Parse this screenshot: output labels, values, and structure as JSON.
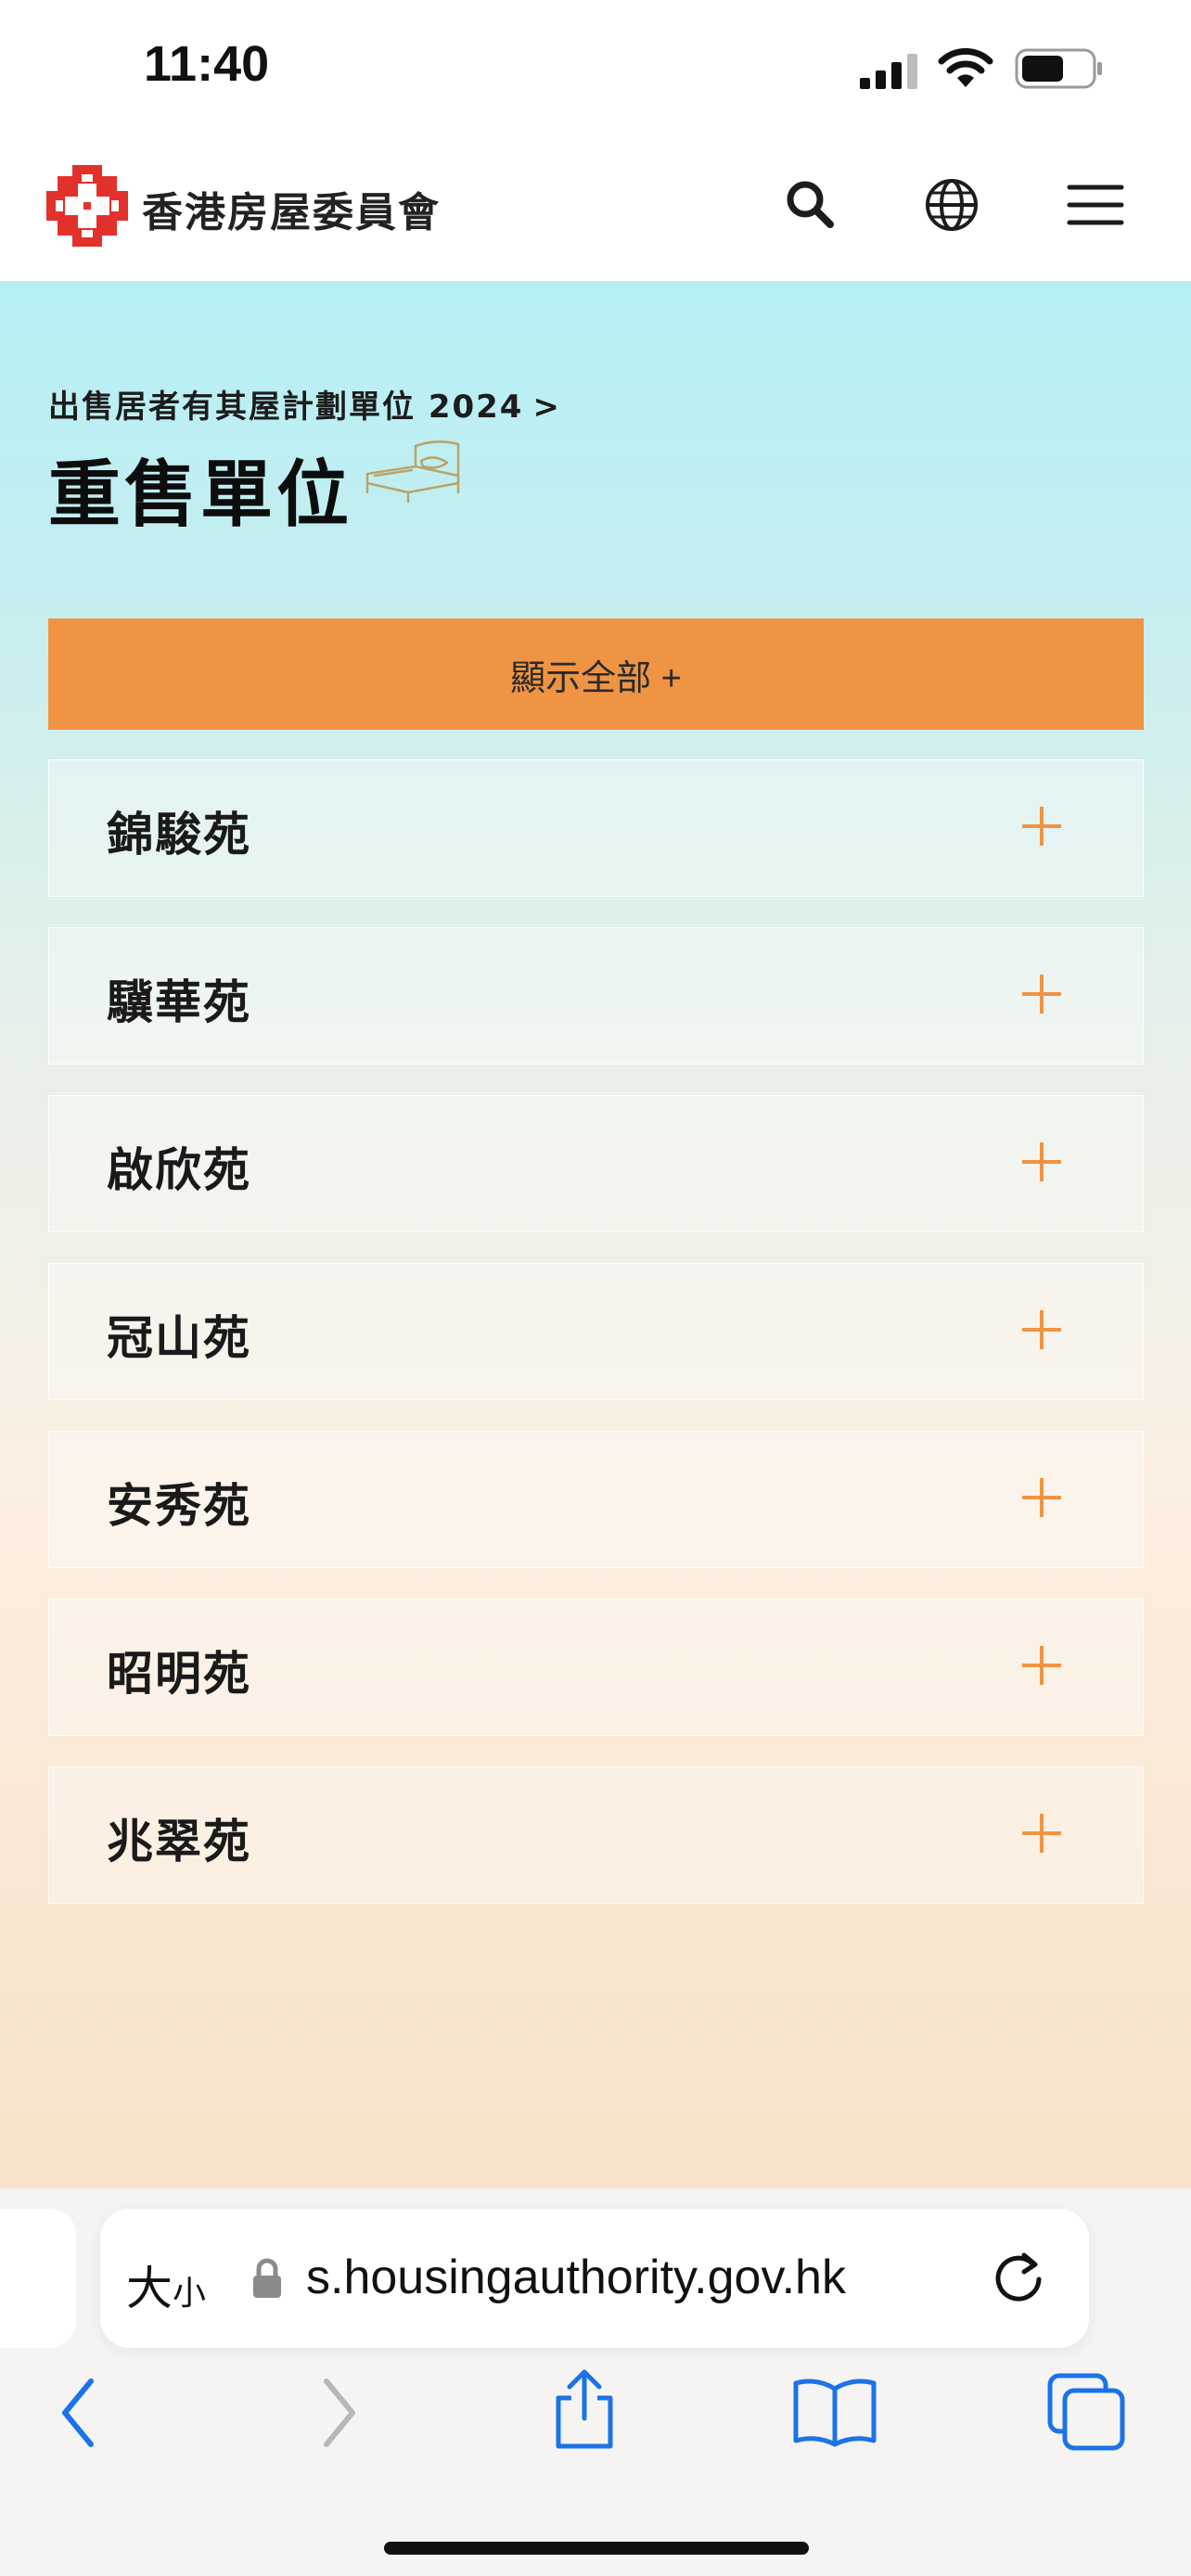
{
  "status_bar": {
    "time": "11:40"
  },
  "header": {
    "logo_icon": "housing-authority-logo",
    "brand": "香港房屋委員會",
    "icons": [
      "search-icon",
      "globe-icon",
      "menu-icon"
    ]
  },
  "page": {
    "breadcrumb": "出售居者有其屋計劃單位 2024",
    "breadcrumb_arrow": ">",
    "title": "重售單位",
    "title_icon": "bed-icon",
    "show_all_label": "顯示全部 +"
  },
  "estates": [
    {
      "name": "錦駿苑"
    },
    {
      "name": "驥華苑"
    },
    {
      "name": "啟欣苑"
    },
    {
      "name": "冠山苑"
    },
    {
      "name": "安秀苑"
    },
    {
      "name": "昭明苑"
    },
    {
      "name": "兆翠苑"
    }
  ],
  "browser": {
    "aa_label": "大",
    "aa_small": "小",
    "url": "s.housingauthority.gov.hk",
    "toolbar_icons": [
      "back-icon",
      "forward-icon",
      "share-icon",
      "bookmarks-icon",
      "tabs-icon"
    ]
  },
  "colors": {
    "accent": "#ef9443",
    "logo_red": "#e2312b",
    "safari_blue": "#1a73e8"
  }
}
